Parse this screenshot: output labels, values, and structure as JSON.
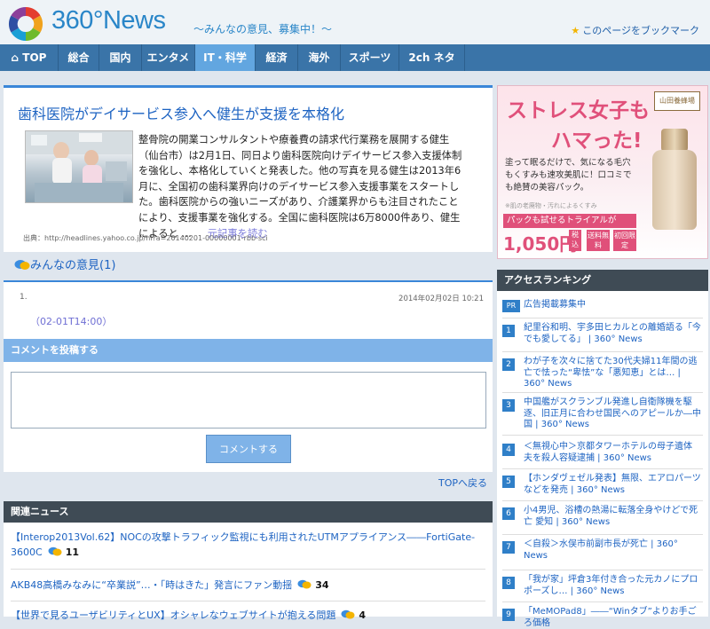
{
  "header": {
    "brand": "360°News",
    "tagline": "～みんなの意見、募集中！～",
    "bookmark_label": "このページをブックマーク"
  },
  "nav": {
    "tabs": [
      {
        "label": "TOP",
        "icon": "home-icon"
      },
      {
        "label": "総合"
      },
      {
        "label": "国内"
      },
      {
        "label": "エンタメ"
      },
      {
        "label": "IT・科学",
        "active": true
      },
      {
        "label": "経済"
      },
      {
        "label": "海外"
      },
      {
        "label": "スポーツ"
      },
      {
        "label": "2ch ネタ"
      }
    ]
  },
  "article": {
    "title": "歯科医院がデイサービス参入へ健生が支援を本格化",
    "body": "整骨院の開業コンサルタントや療養費の請求代行業務を展開する健生（仙台市）は2月1日、同日より歯科医院向けデイサービス参入支援体制を強化し、本格化していくと発表した。他の写真を見る健生は2013年6月に、全国初の歯科業界向けのデイサービス参入支援事業をスタートした。歯科医院からの強いニーズがあり、介護業界からも注目されたことにより、支援事業を強化する。全国に歯科医院は6万8000件あり、健生によると …",
    "more_label": "元記事を読む",
    "source": "出典：http://headlines.yahoo.co.jp/hl?a=20140201-00000001-rbb-sci"
  },
  "opinions": {
    "heading": "みんなの意見(1)",
    "comments": [
      {
        "number": "1.",
        "date": "2014年02月02日 10:21",
        "text": "（02-01T14:00）"
      }
    ]
  },
  "post": {
    "heading": "コメントを投稿する",
    "button_label": "コメントする"
  },
  "top_back": "TOPへ戻る",
  "related": {
    "heading": "関連ニュース",
    "items": [
      {
        "title": "【Interop2013Vol.62】NOCの攻撃トラフィック監視にも利用されたUTMアプライアンス――FortiGate-3600C",
        "count": "11"
      },
      {
        "title": "AKB48高橋みなみに“卒業説”…・「時はきた」発言にファン動揺",
        "count": "34"
      },
      {
        "title": "【世界で見るユーザビリティとUX】オシャレなウェブサイトが抱える問題",
        "count": "4"
      }
    ]
  },
  "ad": {
    "brand": "山田養蜂場",
    "headline1": "ストレス女子も",
    "headline2": "ハマった!",
    "copy": "塗って眠るだけで、気になる毛穴もくすみも速攻美肌に！口コミでも絶賛の美容パック。",
    "note": "※肌の老廃物・汚れによるくすみ",
    "trial_label": "パックも試せるトライアルが",
    "price": "1,050円",
    "tax": "税込",
    "badge1": "送料無料",
    "badge2": "初回限定"
  },
  "ranking": {
    "heading": "アクセスランキング",
    "items": [
      {
        "rank": "PR",
        "title": "広告掲載募集中"
      },
      {
        "rank": "1",
        "title": "紀里谷和明、宇多田ヒカルとの離婚語る「今でも愛してる」 | 360° News"
      },
      {
        "rank": "2",
        "title": "わが子を次々に捨てた30代夫婦11年間の逃亡で怯った“卑怯”な「悪知恵」とは… | 360° News"
      },
      {
        "rank": "3",
        "title": "中国艦がスクランブル発進し自衛隊機を駆逐、旧正月に合わせ国民へのアピールか―中国 | 360° News"
      },
      {
        "rank": "4",
        "title": "＜無視心中＞京都タワーホテルの母子遺体 夫を殺人容疑逮捕 | 360° News"
      },
      {
        "rank": "5",
        "title": "【ホンダヴェゼル発表】無限、エアロパーツなどを発売 | 360° News"
      },
      {
        "rank": "6",
        "title": "小4男児、浴槽の熱湯に転落全身やけどで死亡 愛知 | 360° News"
      },
      {
        "rank": "7",
        "title": "＜自殺＞水俣市前副市長が死亡 | 360° News"
      },
      {
        "rank": "8",
        "title": "「我が家」坪倉3年付き合った元カノにプロポーズし… | 360° News"
      },
      {
        "rank": "9",
        "title": "「MeMOPad8」――“Winタブ”よりお手ごろ価格"
      }
    ]
  },
  "colors": {
    "nav_bg": "#3a74a8",
    "nav_active": "#62a6e0",
    "link_blue": "#1d63c2",
    "section_dark": "#3f4b55",
    "post_head": "#7fb3e8",
    "ad_pink": "#e0507a"
  }
}
